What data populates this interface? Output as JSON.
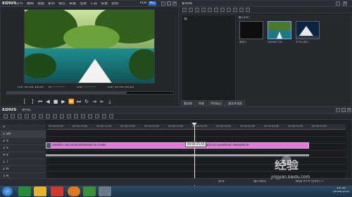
{
  "player": {
    "logo": "EDIUS",
    "menu": [
      "文件",
      "编辑",
      "视图",
      "素材",
      "模式",
      "采集",
      "渲染",
      "工具",
      "设置",
      "帮助"
    ],
    "plr": "PLR",
    "rec": "REC",
    "tc_cur": "Cur 00:00:16;00",
    "tc_in": "In --:--:--;--",
    "tc_out": "Out --:--:--;--",
    "tc_dur": "Dur 00:00:33;16"
  },
  "bin": {
    "title": "素材库",
    "root": "根",
    "folder_count": "根 (2/2)",
    "tree_item": "根",
    "clip1_label": "2e69ff2736...",
    "clip2_label": "370ecdbf...",
    "tabs": [
      "素材库",
      "特效",
      "序列标记",
      "源文件浏览"
    ]
  },
  "timeline": {
    "logo": "EDIUS",
    "sequence": "序列1",
    "ruler": [
      "00:00:00;00",
      "00:00:05;00",
      "00:00:10;00",
      "00:00:15;00",
      "00:00:20;00",
      "00:00:25;00",
      "00:00:30;00",
      "00:00:35;00",
      "00:00:40;00",
      "00:00:45;00",
      "00:00:50;00",
      "00:00:55;00"
    ],
    "tracks": [
      "V",
      "1 VA",
      "2 V",
      "3 V",
      "4 V",
      "1 T",
      "2 A",
      "3 A"
    ],
    "clip_a": "2e69ff2736c2e1b19600d28c7b7f5e8f",
    "clip_b": "370ecdbf55107a264654c76eda8f639",
    "tooltip": "00:00:15;16",
    "status_left": "暂停",
    "status_right": "插入模式",
    "status_mid": "磁盘:93% 已用(C:)"
  },
  "taskbar": {
    "time": "19:50",
    "date": "2016/5/10"
  },
  "watermark": {
    "main": "经验",
    "sub": "jingyan.baidu.com"
  }
}
